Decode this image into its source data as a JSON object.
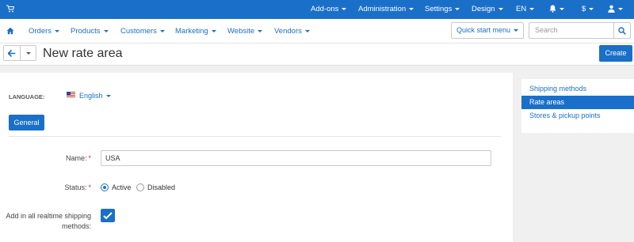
{
  "topbar": {
    "menus": [
      "Add-ons",
      "Administration",
      "Settings",
      "Design",
      "EN",
      "",
      "$",
      ""
    ]
  },
  "nav": {
    "items": [
      "Orders",
      "Products",
      "Customers",
      "Marketing",
      "Website",
      "Vendors"
    ],
    "quick_start": "Quick start menu",
    "search_placeholder": "Search"
  },
  "title": "New rate area",
  "create_label": "Create",
  "form": {
    "language_label": "LANGUAGE:",
    "language_value": "English",
    "tab_general": "General",
    "name_label": "Name:",
    "name_value": "USA",
    "status_label": "Status:",
    "status_options": [
      "Active",
      "Disabled"
    ],
    "status_selected": "Active",
    "realtime_label_line1": "Add in all realtime shipping",
    "realtime_label_line2": "methods:",
    "realtime_checked": true,
    "required_mark": "*"
  },
  "sidebar": {
    "items": [
      "Shipping methods",
      "Rate areas",
      "Stores & pickup points"
    ],
    "active": "Rate areas"
  },
  "colors": {
    "primary": "#1a6fc9",
    "required": "#e02a2a"
  }
}
